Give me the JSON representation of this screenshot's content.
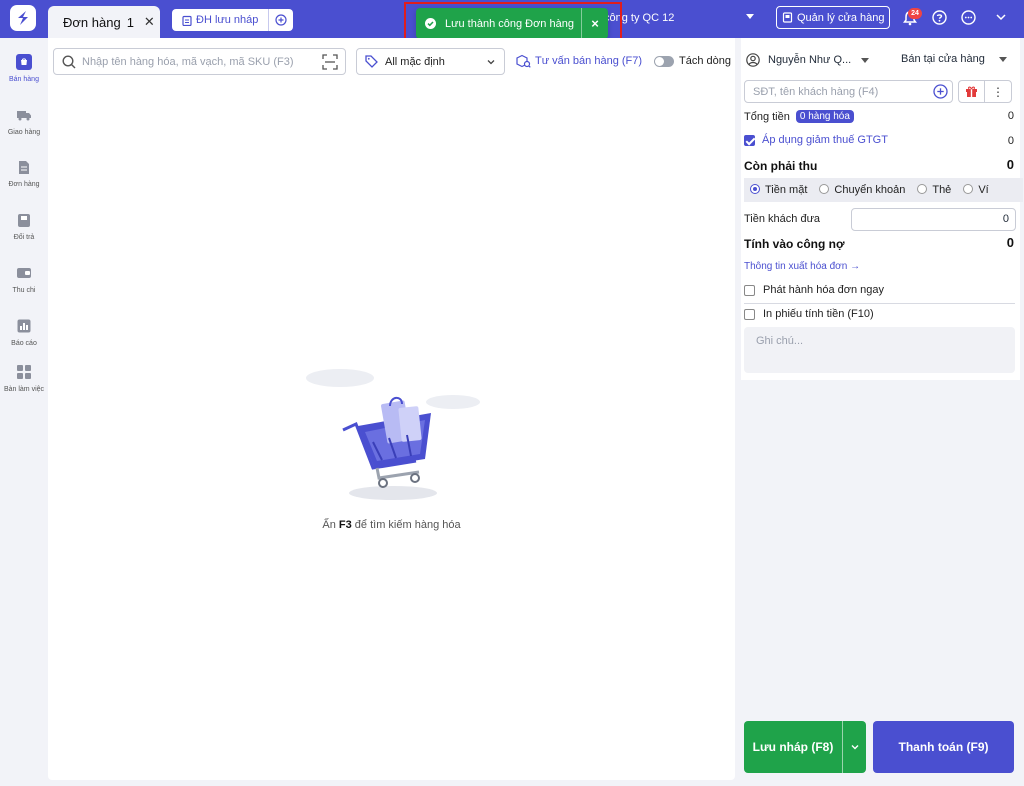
{
  "topbar": {
    "tab_label": "Đơn hàng",
    "tab_number": "1",
    "tab_close": "✕",
    "draft_button": "ĐH lưu nháp",
    "company": "công ty QC 12",
    "store_manage": "Quản lý cửa hàng",
    "notification_count": "24"
  },
  "toast": {
    "message": "Lưu thành công Đơn hàng",
    "close": "×"
  },
  "leftnav": {
    "items": [
      {
        "label": "Bán hàng",
        "icon": "cart-icon"
      },
      {
        "label": "Giao hàng",
        "icon": "truck-icon"
      },
      {
        "label": "Đơn hàng",
        "icon": "document-icon"
      },
      {
        "label": "Đổi trả",
        "icon": "return-box-icon"
      },
      {
        "label": "Thu chi",
        "icon": "wallet-icon"
      },
      {
        "label": "Báo cáo",
        "icon": "chart-icon"
      },
      {
        "label": "Bàn làm việc",
        "icon": "grid-icon"
      }
    ]
  },
  "main": {
    "search_placeholder": "Nhập tên hàng hóa, mã vạch, mã SKU (F3)",
    "price_list": "All mặc định",
    "consult_link": "Tư vấn bán hàng (F7)",
    "split_label": "Tách dòng",
    "empty_prefix": "Ấn ",
    "empty_key": "F3",
    "empty_suffix": " để tìm kiếm hàng hóa"
  },
  "order": {
    "seller": "Nguyễn Như Q...",
    "channel": "Bán tại cửa hàng",
    "customer_placeholder": "SĐT, tên khách hàng (F4)",
    "more": "⋮",
    "total_label": "Tổng tiền",
    "total_items": "0 hàng hóa",
    "total_value": "0",
    "vat_label": "Áp dụng giảm thuế GTGT",
    "vat_value": "0",
    "due_label": "Còn phải thu",
    "due_value": "0",
    "pay_methods": [
      "Tiền mặt",
      "Chuyển khoản",
      "Thẻ",
      "Ví"
    ],
    "paid_label": "Tiền khách đưa",
    "paid_value": "0",
    "debt_label": "Tính vào công nợ",
    "debt_value": "0",
    "invoice_info": "Thông tin xuất hóa đơn →",
    "issue_invoice": "Phát hành hóa đơn ngay",
    "print_receipt": "In phiếu tính tiền (F10)",
    "note_placeholder": "Ghi chú...",
    "save_draft": "Lưu nháp (F8)",
    "checkout": "Thanh toán (F9)"
  },
  "colors": {
    "brand": "#4a4fd0",
    "success": "#1fa34a",
    "danger": "#ef4444"
  }
}
